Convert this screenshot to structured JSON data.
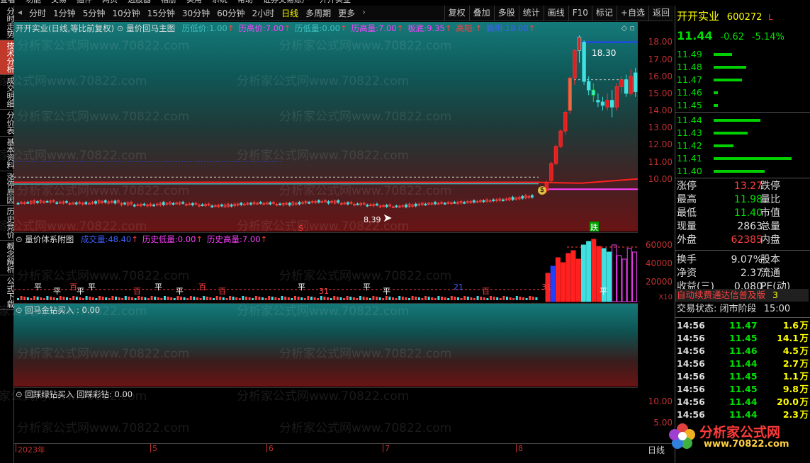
{
  "menubar": [
    "查看",
    "功能",
    "交易",
    "插件",
    "网页",
    "选股器",
    "相册",
    "实用",
    "系统",
    "帮助",
    "证券交易账户",
    "开开实业"
  ],
  "toolbar": {
    "periods": [
      "分时",
      "1分钟",
      "5分钟",
      "10分钟",
      "15分钟",
      "30分钟",
      "60分钟",
      "2小时",
      "日线",
      "多周期",
      "更多"
    ],
    "active_period": "日线",
    "right": [
      "复权",
      "叠加",
      "多股",
      "统计",
      "画线",
      "F10",
      "标记",
      "+自选",
      "返回"
    ]
  },
  "leftnav": [
    "分时走势",
    "技术分析",
    "成交明细",
    "分价表",
    "基本资料",
    "涨停原因",
    "历史竞价",
    "概念解析",
    "公式下载"
  ],
  "leftnav_active": "技术分析",
  "main_panel": {
    "title_prefix": "开开实业(日线,等比前复权)",
    "indicator": "量价回马主图",
    "fields": [
      {
        "label": "历低价:",
        "value": "1.00",
        "color": "#40c0c0"
      },
      {
        "label": "历高价:",
        "value": "7.00",
        "color": "#ff40ff"
      },
      {
        "label": "历低量:",
        "value": "0.00",
        "color": "#40c0c0"
      },
      {
        "label": "历高量:",
        "value": "7.00",
        "color": "#ff40ff"
      },
      {
        "label": "板底:",
        "value": "9.35",
        "color": "#ff40ff"
      },
      {
        "label": "高阳:",
        "value": "",
        "color": "#ff4040"
      },
      {
        "label": "高阴:",
        "value": "18.00",
        "color": "#4060ff"
      }
    ],
    "high_label": "18.30",
    "low_label": "8.39",
    "die_label": "跌",
    "dollar_label": "$",
    "y_ticks": [
      "18.00",
      "17.00",
      "16.00",
      "15.00",
      "14.00",
      "13.00",
      "12.00",
      "11.00",
      "10.00"
    ]
  },
  "vol_panel": {
    "title": "量价体系附图",
    "fields": [
      {
        "label": "成交量:",
        "value": "48.40",
        "color": "#4060ff"
      },
      {
        "label": "历史低量:",
        "value": "0.00",
        "color": "#ff40ff"
      },
      {
        "label": "历史高量:",
        "value": "7.00",
        "color": "#ff40ff"
      }
    ],
    "y_ticks": [
      "60000",
      "40000",
      "20000"
    ],
    "unit": "X10",
    "marks": [
      "平",
      "平",
      "百",
      "平",
      "平",
      "百",
      "平",
      "平",
      "百",
      "百",
      "平",
      "31",
      "平",
      "平",
      "21",
      "百",
      "31",
      "平",
      "太"
    ]
  },
  "panel3": {
    "title": "回马金钻买入",
    "value": ": 0.00"
  },
  "panel4": {
    "title": "回踩绿钻买入",
    "title2": "回踩彩钻:",
    "value": "0.00",
    "y_ticks": [
      "10.00",
      "5.00"
    ]
  },
  "xaxis": {
    "labels": [
      "2023年",
      "5",
      "6",
      "7",
      "8"
    ],
    "right_label": "日线"
  },
  "watermark": "分析家公式网www.70822.com",
  "quote": {
    "name": "开开实业",
    "code": "600272",
    "flag": "L",
    "price": "11.44",
    "change": "-0.62",
    "pct": "-5.14%",
    "asks": [
      {
        "p": "11.49",
        "w": 26
      },
      {
        "p": "11.48",
        "w": 46
      },
      {
        "p": "11.47",
        "w": 40
      },
      {
        "p": "11.46",
        "w": 6
      },
      {
        "p": "11.45",
        "w": 6
      }
    ],
    "bids": [
      {
        "p": "11.44",
        "w": 66
      },
      {
        "p": "11.43",
        "w": 48
      },
      {
        "p": "11.42",
        "w": 28
      },
      {
        "p": "11.41",
        "w": 110
      },
      {
        "p": "11.40",
        "w": 72
      }
    ],
    "stats": [
      {
        "l": "涨停",
        "v": "13.27",
        "c": "red",
        "r": "跌停"
      },
      {
        "l": "最高",
        "v": "11.98",
        "c": "green",
        "r": "量比"
      },
      {
        "l": "最低",
        "v": "11.40",
        "c": "green",
        "r": "市值"
      },
      {
        "l": "现量",
        "v": "2863",
        "c": "white",
        "r": "总量"
      },
      {
        "l": "外盘",
        "v": "62385",
        "c": "red",
        "r": "内盘"
      },
      {
        "l": "换手",
        "v": "9.07%",
        "c": "white",
        "r": "股本"
      },
      {
        "l": "净资",
        "v": "2.37",
        "c": "white",
        "r": "流通"
      },
      {
        "l": "收益(三)",
        "v": "0.080",
        "c": "white",
        "r": "PE(动)"
      }
    ],
    "banner": "自动续费通达信普及版",
    "banner_num": "3",
    "status_label": "交易状态:",
    "status": "闭市阶段",
    "status_time": "15:00",
    "ticks": [
      {
        "t": "14:56",
        "p": "11.47",
        "v": "1.6",
        "u": "万"
      },
      {
        "t": "14:56",
        "p": "11.45",
        "v": "14.1",
        "u": "万"
      },
      {
        "t": "14:56",
        "p": "11.46",
        "v": "4.5",
        "u": "万"
      },
      {
        "t": "14:56",
        "p": "11.44",
        "v": "2.7",
        "u": "万"
      },
      {
        "t": "14:56",
        "p": "11.45",
        "v": "1.1",
        "u": "万"
      },
      {
        "t": "14:56",
        "p": "11.45",
        "v": "9.8",
        "u": "万"
      },
      {
        "t": "14:56",
        "p": "11.44",
        "v": "20.0",
        "u": "万"
      },
      {
        "t": "14:56",
        "p": "11.44",
        "v": "2.3",
        "u": "万"
      }
    ],
    "logo_text": "分析家公式网",
    "logo_url": "www.70822.com"
  },
  "chart_data": {
    "type": "candlestick",
    "title": "开开实业(日线,等比前复权)",
    "series": [
      {
        "name": "close",
        "values": [
          8.6,
          8.7,
          8.65,
          8.6,
          8.55,
          8.6,
          8.7,
          8.6,
          8.5,
          8.45,
          8.5,
          8.6,
          8.55,
          8.5,
          8.45,
          8.4,
          8.5,
          8.55,
          8.6,
          8.55,
          8.5,
          8.6,
          8.65,
          8.7,
          8.6,
          8.55,
          8.5,
          8.45,
          8.4,
          8.39,
          8.5,
          8.55,
          8.6,
          8.6,
          8.65,
          8.7,
          8.75,
          8.8,
          8.9,
          9.0,
          9.9,
          10.9,
          11.9,
          12.8,
          13.9,
          15.9,
          17.5,
          18.3,
          15.7,
          15.2,
          14.9,
          14.5,
          14.3,
          14.6,
          14.2,
          15.4,
          15.8,
          15.0,
          16.0,
          15.1
        ]
      }
    ],
    "ylim": [
      8.0,
      18.6
    ]
  }
}
